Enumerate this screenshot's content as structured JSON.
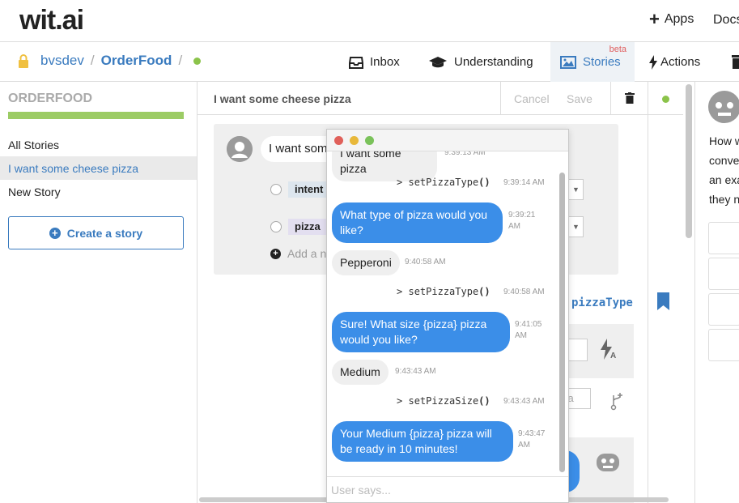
{
  "header": {
    "logo": "wit.ai",
    "apps_label": "Apps",
    "docs_label": "Docs"
  },
  "nav": {
    "breadcrumb_user": "bvsdev",
    "breadcrumb_app": "OrderFood",
    "separator": "/",
    "tabs": [
      {
        "label": "Inbox",
        "icon": "inbox-icon"
      },
      {
        "label": "Understanding",
        "icon": "graduation-cap-icon"
      },
      {
        "label": "Stories",
        "icon": "image-icon",
        "badge": "beta"
      },
      {
        "label": "Actions",
        "icon": "bolt-icon"
      }
    ]
  },
  "sidebar": {
    "title": "ORDERFOOD",
    "items": [
      "All Stories",
      "I want some cheese pizza",
      "New Story"
    ],
    "create_button": "Create a story"
  },
  "story": {
    "title": "I want some cheese pizza",
    "cancel": "Cancel",
    "save": "Save",
    "user_input": "I want some cheese pizza",
    "entities": [
      "intent",
      "pizza"
    ],
    "add_label": "Add a new entity",
    "action_name": "pizzaType",
    "code_fragment": "t)",
    "entity_fragment": "za"
  },
  "right_panel": {
    "lines": [
      "How w",
      "conve",
      "an exa",
      "they n"
    ]
  },
  "chat": {
    "input_placeholder": "User says...",
    "messages": [
      {
        "kind": "user",
        "text": "I want some pizza",
        "time": "9:39:13 AM"
      },
      {
        "kind": "action",
        "fn": "setPizzaType",
        "time": "9:39:14 AM"
      },
      {
        "kind": "bot",
        "text": "What type of pizza would you like?",
        "time": "9:39:21 AM"
      },
      {
        "kind": "user",
        "text": "Pepperoni",
        "time": "9:40:58 AM"
      },
      {
        "kind": "action",
        "fn": "setPizzaType",
        "time": "9:40:58 AM"
      },
      {
        "kind": "bot",
        "text": "Sure! What size {pizza} pizza would you like?",
        "time": "9:41:05 AM"
      },
      {
        "kind": "user",
        "text": "Medium",
        "time": "9:43:43 AM"
      },
      {
        "kind": "action",
        "fn": "setPizzaSize",
        "time": "9:43:43 AM"
      },
      {
        "kind": "bot",
        "text": "Your Medium {pizza} pizza will be ready in 10 minutes!",
        "time": "9:43:47 AM"
      }
    ],
    "action_prefix": ">",
    "action_parens": "()"
  },
  "colors": {
    "accent": "#3a7bbf",
    "bot_bubble": "#3b8ee8",
    "progress": "#9ccc65",
    "status_green": "#8bc34a"
  }
}
